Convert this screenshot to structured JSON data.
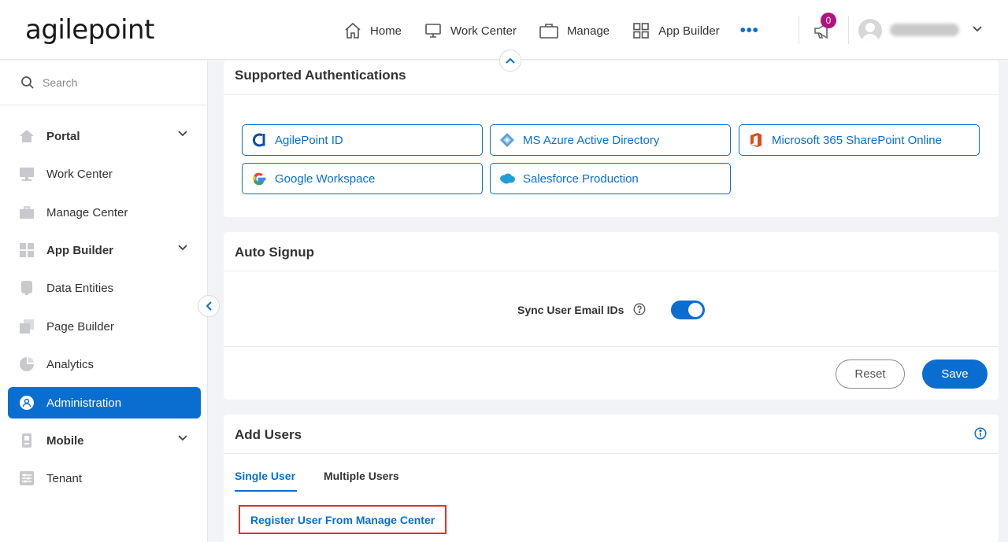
{
  "header": {
    "logo": "agilepoint",
    "nav": [
      {
        "label": "Home",
        "icon": "home-icon"
      },
      {
        "label": "Work Center",
        "icon": "monitor-icon"
      },
      {
        "label": "Manage",
        "icon": "briefcase-icon"
      },
      {
        "label": "App Builder",
        "icon": "grid-icon"
      }
    ],
    "more": "•••",
    "notification_count": "0"
  },
  "sidebar": {
    "search_placeholder": "Search",
    "items": [
      {
        "label": "Portal",
        "icon": "home-icon",
        "expandable": true
      },
      {
        "label": "Work Center",
        "icon": "monitor-icon"
      },
      {
        "label": "Manage Center",
        "icon": "briefcase-icon"
      },
      {
        "label": "App Builder",
        "icon": "grid-icon",
        "expandable": true
      },
      {
        "label": "Data Entities",
        "icon": "database-icon"
      },
      {
        "label": "Page Builder",
        "icon": "pages-icon"
      },
      {
        "label": "Analytics",
        "icon": "pie-chart-icon"
      },
      {
        "label": "Administration",
        "icon": "admin-icon",
        "active": true
      },
      {
        "label": "Mobile",
        "icon": "mobile-icon",
        "expandable": true
      },
      {
        "label": "Tenant",
        "icon": "sliders-icon"
      }
    ]
  },
  "auth": {
    "title": "Supported Authentications",
    "providers": [
      {
        "label": "AgilePoint ID",
        "icon": "agilepoint-logo-icon"
      },
      {
        "label": "MS Azure Active Directory",
        "icon": "azure-ad-logo-icon"
      },
      {
        "label": "Microsoft 365 SharePoint Online",
        "icon": "office365-logo-icon"
      },
      {
        "label": "Google Workspace",
        "icon": "google-logo-icon"
      },
      {
        "label": "Salesforce Production",
        "icon": "salesforce-logo-icon"
      }
    ]
  },
  "signup": {
    "title": "Auto Signup",
    "sync_label": "Sync User Email IDs",
    "sync_enabled": true,
    "reset_label": "Reset",
    "save_label": "Save"
  },
  "add_users": {
    "title": "Add Users",
    "tabs": [
      "Single User",
      "Multiple Users"
    ],
    "active_tab": "Single User",
    "register_link": "Register User From Manage Center"
  },
  "colors": {
    "accent": "#0a6ed1",
    "badge": "#b3127d",
    "highlight_border": "#d9342b"
  }
}
